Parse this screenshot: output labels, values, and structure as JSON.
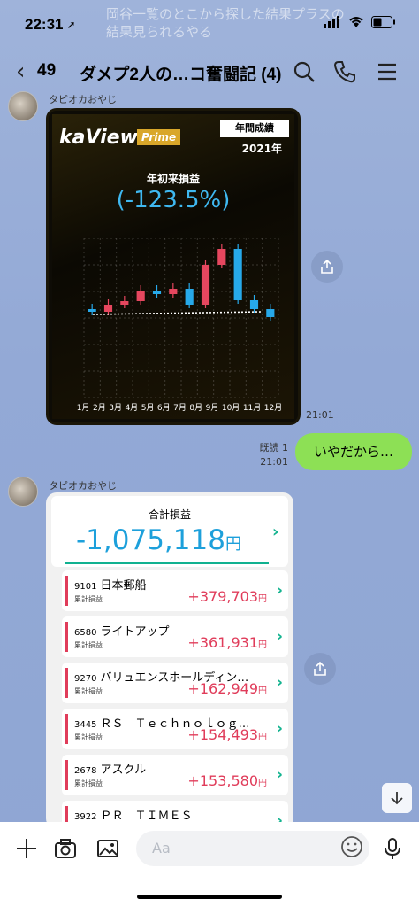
{
  "status": {
    "time": "22:31"
  },
  "banner_ghost": "岡谷一覧のとこから探した結果プラスの結果見られるやる",
  "nav": {
    "back_count": "49",
    "title": "ダメプ2人の…コ奮闘記 (4)"
  },
  "messages": [
    {
      "sender": "タピオカおやじ",
      "time": "21:01",
      "kaview": {
        "logo": "kaView",
        "prime": "Prime",
        "badge": "年間成績",
        "year": "2021年",
        "label": "年初来損益",
        "pct": "(-123.5%)"
      }
    },
    {
      "mine": true,
      "text": "いやだから…",
      "read": "既読 1",
      "time": "21:01"
    },
    {
      "sender": "タピオカおやじ",
      "card": {
        "total_label": "合計損益",
        "total_value": "-1,075,118",
        "total_unit": "円",
        "rows": [
          {
            "code": "9101",
            "name": "日本郵船",
            "sub": "累計損益",
            "value": "+379,703",
            "unit": "円"
          },
          {
            "code": "6580",
            "name": "ライトアップ",
            "sub": "累計損益",
            "value": "+361,931",
            "unit": "円"
          },
          {
            "code": "9270",
            "name": "バリュエンスホールディン…",
            "sub": "累計損益",
            "value": "+162,949",
            "unit": "円"
          },
          {
            "code": "3445",
            "name": "ＲＳ　Ｔｅｃｈｎｏｌｏｇ…",
            "sub": "累計損益",
            "value": "+154,493",
            "unit": "円"
          },
          {
            "code": "2678",
            "name": "アスクル",
            "sub": "累計損益",
            "value": "+153,580",
            "unit": "円"
          },
          {
            "code": "3922",
            "name": "ＰＲ　ＴＩＭＥＳ",
            "sub": "",
            "value": "",
            "unit": ""
          }
        ]
      }
    }
  ],
  "input": {
    "placeholder": "Aa"
  },
  "chart_data": {
    "type": "bar",
    "categories": [
      "1月",
      "2月",
      "3月",
      "4月",
      "5月",
      "6月",
      "7月",
      "8月",
      "9月",
      "10月",
      "11月",
      "12月"
    ],
    "series": [
      {
        "values": [
          -3,
          8,
          4,
          12,
          -4,
          6,
          -18,
          45,
          18,
          -58,
          -10,
          -9
        ]
      }
    ],
    "colors": {
      "up": "#e6475f",
      "down": "#27a9ea"
    }
  }
}
